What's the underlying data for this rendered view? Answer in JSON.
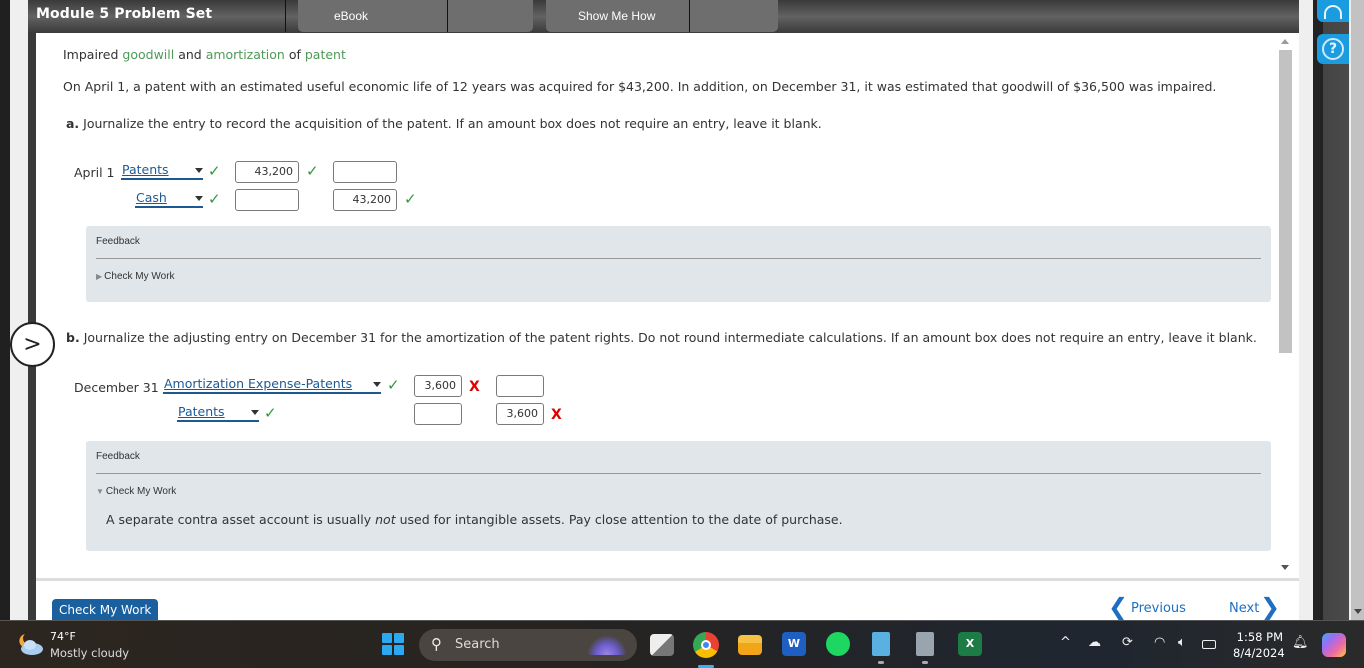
{
  "header": {
    "title": "Module 5 Problem Set",
    "tabs": [
      {
        "label": "eBook"
      },
      {
        "label": "Show Me How"
      }
    ]
  },
  "problem": {
    "title_parts": [
      {
        "text": "Impaired ",
        "highlight": false
      },
      {
        "text": "goodwill",
        "highlight": true
      },
      {
        "text": " and ",
        "highlight": false
      },
      {
        "text": "amortization",
        "highlight": true
      },
      {
        "text": " of ",
        "highlight": false
      },
      {
        "text": "patent",
        "highlight": true
      }
    ],
    "statement": "On April 1, a patent with an estimated useful economic life of 12 years was acquired for $43,200. In addition, on December 31, it was estimated that goodwill of $36,500 was impaired."
  },
  "part_a": {
    "label": "a.",
    "instruction": "Journalize the entry to record the acquisition of the patent. If an amount box does not require an entry, leave it blank.",
    "date": "April 1",
    "rows": [
      {
        "account": "Patents",
        "account_status": "correct",
        "debit": "43,200",
        "debit_status": "correct",
        "credit": "",
        "credit_status": ""
      },
      {
        "account": "Cash",
        "account_status": "correct",
        "debit": "",
        "debit_status": "",
        "credit": "43,200",
        "credit_status": "correct"
      }
    ],
    "feedback": {
      "title": "Feedback",
      "toggle": "Check My Work",
      "expanded": false
    }
  },
  "part_b": {
    "label": "b.",
    "instruction": "Journalize the adjusting entry on December 31 for the amortization of the patent rights. Do not round intermediate calculations. If an amount box does not require an entry, leave it blank.",
    "date": "December 31",
    "rows": [
      {
        "account": "Amortization Expense-Patents",
        "account_status": "correct",
        "debit": "3,600",
        "debit_status": "incorrect",
        "credit": "",
        "credit_status": ""
      },
      {
        "account": "Patents",
        "account_status": "correct",
        "debit": "",
        "debit_status": "",
        "credit": "3,600",
        "credit_status": "incorrect"
      }
    ],
    "feedback": {
      "title": "Feedback",
      "toggle": "Check My Work",
      "expanded": true,
      "message_before": "A separate contra asset account is usually ",
      "message_em": "not",
      "message_after": " used for intangible assets. Pay close attention to the date of purchase."
    }
  },
  "footer": {
    "check_my_work": "Check My Work",
    "previous": "Previous",
    "next": "Next"
  },
  "status_marks": {
    "correct": "✓",
    "incorrect": "X"
  },
  "side": {
    "help": "?",
    "expand": ">"
  },
  "taskbar": {
    "weather_temp": "74°F",
    "weather_desc": "Mostly cloudy",
    "search_label": "Search",
    "time": "1:58 PM",
    "date": "8/4/2024",
    "apps": [
      "task-view",
      "chrome",
      "file-explorer",
      "word",
      "spotify",
      "notepad",
      "calculator",
      "excel"
    ]
  },
  "colors": {
    "accent": "#1a5f9e",
    "link": "#1d6fc2",
    "highlight": "#4d9a57",
    "correct": "#2e9a3a",
    "incorrect": "#e00000",
    "feedback_bg": "#e1e6ea"
  }
}
